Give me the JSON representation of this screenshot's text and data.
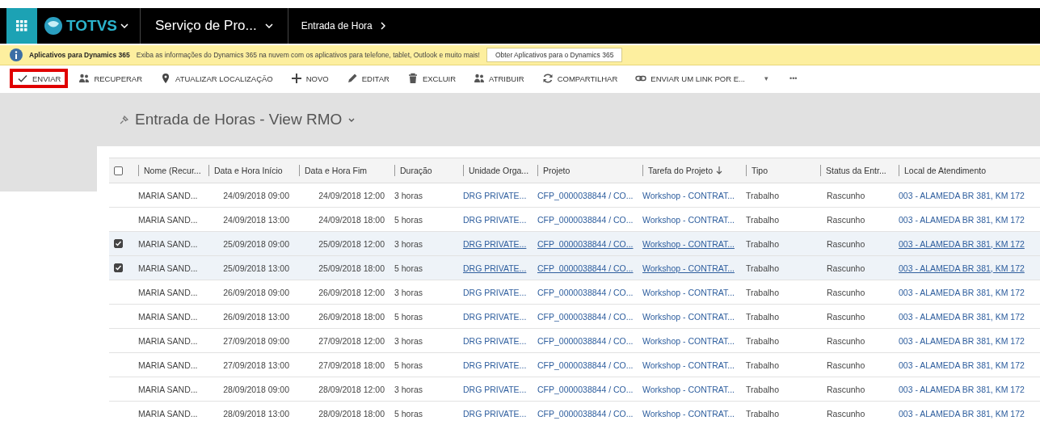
{
  "navbar": {
    "brand": "TOTVS",
    "app": "Serviço de Pro...",
    "breadcrumb": "Entrada de Hora"
  },
  "notification": {
    "title": "Aplicativos para Dynamics 365",
    "message": "Exiba as informações do Dynamics 365 na nuvem com os aplicativos para telefone, tablet, Outlook e muito mais!",
    "button": "Obter Aplicativos para o Dynamics 365"
  },
  "toolbar": [
    {
      "kind": "check",
      "label": "ENVIAR",
      "highlighted": true
    },
    {
      "kind": "people",
      "label": "RECUPERAR",
      "highlighted": false
    },
    {
      "kind": "pin",
      "label": "ATUALIZAR LOCALIZAÇÃO",
      "highlighted": false
    },
    {
      "kind": "plus",
      "label": "NOVO",
      "highlighted": false
    },
    {
      "kind": "pencil",
      "label": "EDITAR",
      "highlighted": false
    },
    {
      "kind": "trash",
      "label": "EXCLUIR",
      "highlighted": false
    },
    {
      "kind": "people",
      "label": "ATRIBUIR",
      "highlighted": false
    },
    {
      "kind": "sync",
      "label": "COMPARTILHAR",
      "highlighted": false
    },
    {
      "kind": "link",
      "label": "ENVIAR UM LINK POR E...",
      "highlighted": false
    },
    {
      "kind": "caret",
      "label": "▾",
      "highlighted": false
    },
    {
      "kind": "more",
      "label": "•••",
      "highlighted": false
    }
  ],
  "view": {
    "title": "Entrada de Horas - View RMO"
  },
  "table": {
    "select_all": false,
    "columns": [
      {
        "label": "Nome (Recur...",
        "sorted": false
      },
      {
        "label": "Data e Hora Início",
        "sorted": false
      },
      {
        "label": "Data e Hora Fim",
        "sorted": false
      },
      {
        "label": "Duração",
        "sorted": false
      },
      {
        "label": "Unidade Orga...",
        "sorted": false
      },
      {
        "label": "Projeto",
        "sorted": false
      },
      {
        "label": "Tarefa do Projeto",
        "sorted": true
      },
      {
        "label": "Tipo",
        "sorted": false
      },
      {
        "label": "Status da Entr...",
        "sorted": false
      },
      {
        "label": "Local de Atendimento",
        "sorted": false
      }
    ],
    "rows": [
      {
        "selected": false,
        "cells": [
          "MARIA SAND...",
          "24/09/2018 09:00",
          "24/09/2018 12:00",
          "3 horas",
          "DRG PRIVATE...",
          "CFP_0000038844 / CO...",
          "Workshop - CONTRAT...",
          "Trabalho",
          "Rascunho",
          "003 - ALAMEDA BR 381, KM 172"
        ]
      },
      {
        "selected": false,
        "cells": [
          "MARIA SAND...",
          "24/09/2018 13:00",
          "24/09/2018 18:00",
          "5 horas",
          "DRG PRIVATE...",
          "CFP_0000038844 / CO...",
          "Workshop - CONTRAT...",
          "Trabalho",
          "Rascunho",
          "003 - ALAMEDA BR 381, KM 172"
        ]
      },
      {
        "selected": true,
        "cells": [
          "MARIA SAND...",
          "25/09/2018 09:00",
          "25/09/2018 12:00",
          "3 horas",
          "DRG PRIVATE...",
          "CFP_0000038844 / CO...",
          "Workshop - CONTRAT...",
          "Trabalho",
          "Rascunho",
          "003 - ALAMEDA BR 381, KM 172"
        ]
      },
      {
        "selected": true,
        "cells": [
          "MARIA SAND...",
          "25/09/2018 13:00",
          "25/09/2018 18:00",
          "5 horas",
          "DRG PRIVATE...",
          "CFP_0000038844 / CO...",
          "Workshop - CONTRAT...",
          "Trabalho",
          "Rascunho",
          "003 - ALAMEDA BR 381, KM 172"
        ]
      },
      {
        "selected": false,
        "cells": [
          "MARIA SAND...",
          "26/09/2018 09:00",
          "26/09/2018 12:00",
          "3 horas",
          "DRG PRIVATE...",
          "CFP_0000038844 / CO...",
          "Workshop - CONTRAT...",
          "Trabalho",
          "Rascunho",
          "003 - ALAMEDA BR 381, KM 172"
        ]
      },
      {
        "selected": false,
        "cells": [
          "MARIA SAND...",
          "26/09/2018 13:00",
          "26/09/2018 18:00",
          "5 horas",
          "DRG PRIVATE...",
          "CFP_0000038844 / CO...",
          "Workshop - CONTRAT...",
          "Trabalho",
          "Rascunho",
          "003 - ALAMEDA BR 381, KM 172"
        ]
      },
      {
        "selected": false,
        "cells": [
          "MARIA SAND...",
          "27/09/2018 09:00",
          "27/09/2018 12:00",
          "3 horas",
          "DRG PRIVATE...",
          "CFP_0000038844 / CO...",
          "Workshop - CONTRAT...",
          "Trabalho",
          "Rascunho",
          "003 - ALAMEDA BR 381, KM 172"
        ]
      },
      {
        "selected": false,
        "cells": [
          "MARIA SAND...",
          "27/09/2018 13:00",
          "27/09/2018 18:00",
          "5 horas",
          "DRG PRIVATE...",
          "CFP_0000038844 / CO...",
          "Workshop - CONTRAT...",
          "Trabalho",
          "Rascunho",
          "003 - ALAMEDA BR 381, KM 172"
        ]
      },
      {
        "selected": false,
        "cells": [
          "MARIA SAND...",
          "28/09/2018 09:00",
          "28/09/2018 12:00",
          "3 horas",
          "DRG PRIVATE...",
          "CFP_0000038844 / CO...",
          "Workshop - CONTRAT...",
          "Trabalho",
          "Rascunho",
          "003 - ALAMEDA BR 381, KM 172"
        ]
      },
      {
        "selected": false,
        "cells": [
          "MARIA SAND...",
          "28/09/2018 13:00",
          "28/09/2018 18:00",
          "5 horas",
          "DRG PRIVATE...",
          "CFP_0000038844 / CO...",
          "Workshop - CONTRAT...",
          "Trabalho",
          "Rascunho",
          "003 - ALAMEDA BR 381, KM 172"
        ]
      }
    ]
  }
}
